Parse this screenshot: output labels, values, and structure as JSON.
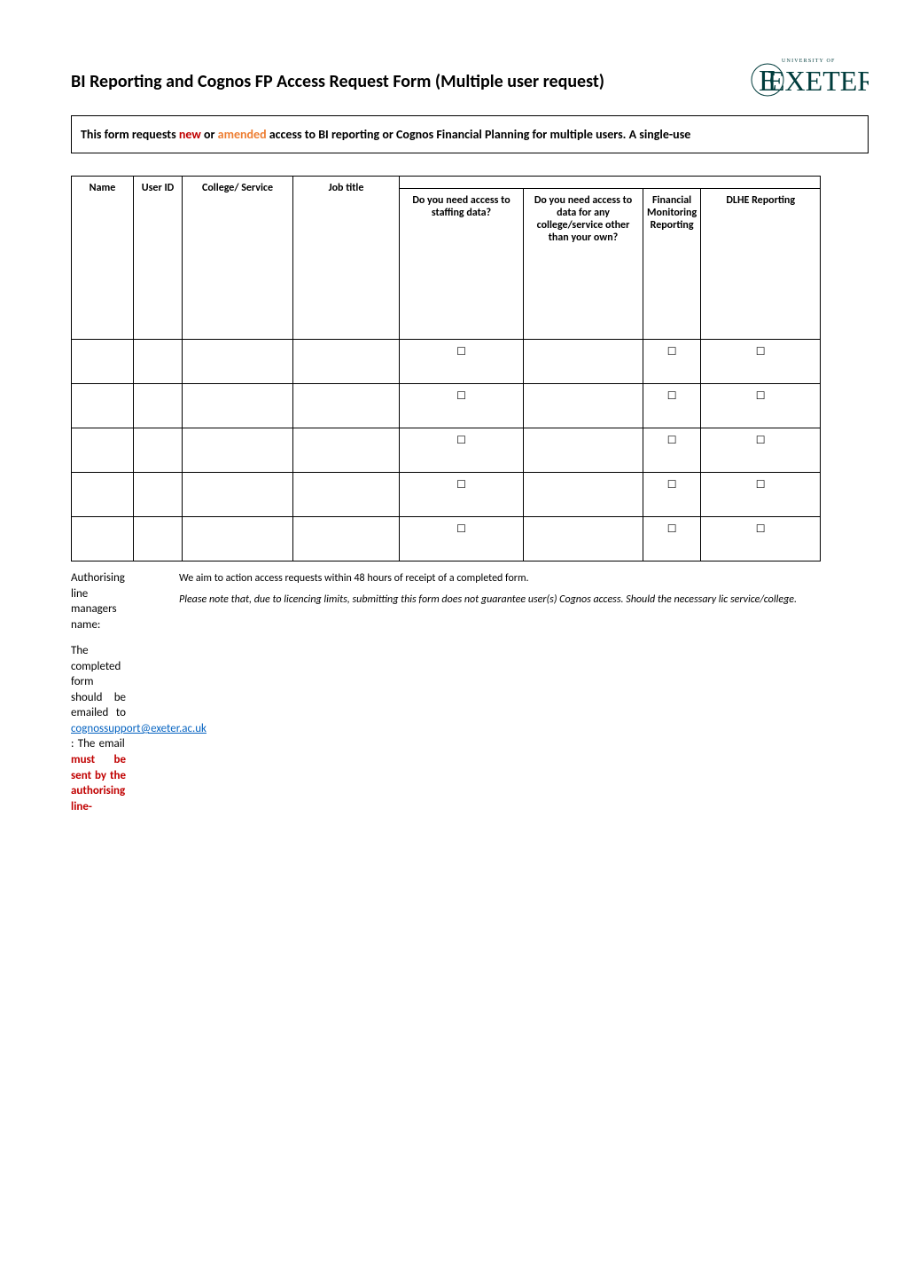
{
  "header": {
    "title": "BI Reporting and Cognos FP Access Request Form (Multiple user request)",
    "logo_top": "UNIVERSITY OF",
    "logo_main": "EXETER"
  },
  "intro": {
    "prefix": "This form requests ",
    "new": "new",
    "mid": " or ",
    "amended": "amended",
    "suffix": " access to BI reporting or Cognos Financial Planning for multiple users. A single-use"
  },
  "table": {
    "headers": {
      "name": "Name",
      "user_id": "User ID",
      "college_service": "College/ Service",
      "job_title": "Job title",
      "staffing": "Do you need access to staffing data?",
      "other_college": "Do you need access to data for any college/service other than your own?",
      "fmr": "Financial Monitoring Reporting",
      "dlhe": "DLHE Reporting"
    },
    "rows": [
      {
        "name": "",
        "user_id": "",
        "college": "",
        "job": "",
        "staffing": "☐",
        "other": "",
        "fmr": "☐",
        "dlhe": "☐"
      },
      {
        "name": "",
        "user_id": "",
        "college": "",
        "job": "",
        "staffing": "☐",
        "other": "",
        "fmr": "☐",
        "dlhe": "☐"
      },
      {
        "name": "",
        "user_id": "",
        "college": "",
        "job": "",
        "staffing": "☐",
        "other": "",
        "fmr": "☐",
        "dlhe": "☐"
      },
      {
        "name": "",
        "user_id": "",
        "college": "",
        "job": "",
        "staffing": "☐",
        "other": "",
        "fmr": "☐",
        "dlhe": "☐"
      },
      {
        "name": "",
        "user_id": "",
        "college": "",
        "job": "",
        "staffing": "☐",
        "other": "",
        "fmr": "☐",
        "dlhe": "☐"
      }
    ]
  },
  "notes": {
    "action_time": "We aim to action access requests within 48 hours of receipt of a completed form.",
    "licence_note": "Please note that, due to licencing limits, submitting this form does not guarantee user(s) Cognos access. Should the necessary lic service/college."
  },
  "left": {
    "auth_label": "Authorising line managers name:",
    "completed_prefix": "The completed form should be emailed to ",
    "email": "cognossupport@exeter.ac.uk",
    "completed_mid": " : The email ",
    "must_sent": "must be sent by the authorising line-"
  }
}
